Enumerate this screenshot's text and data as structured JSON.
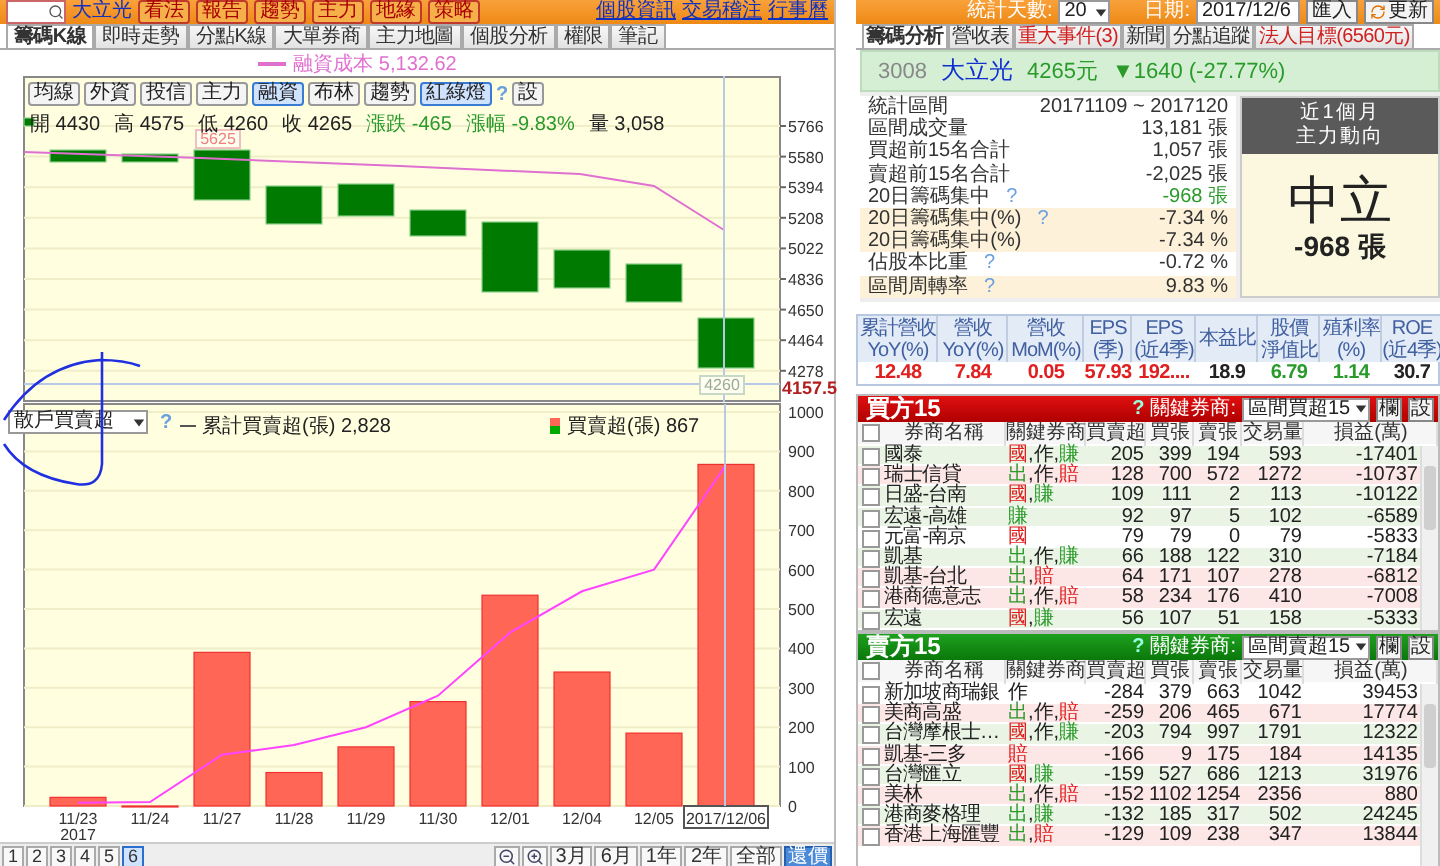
{
  "left_top_bar": {
    "stock_name": "大立光",
    "buttons": [
      "看法",
      "報告",
      "趨勢",
      "主力",
      "地緣",
      "策略"
    ],
    "links": [
      "個股資訊",
      "交易稽注",
      "行事曆"
    ]
  },
  "left_tabs": [
    {
      "label": "籌碼K線",
      "selected": true
    },
    {
      "label": "即時走勢",
      "selected": false
    },
    {
      "label": "分點K線",
      "selected": false
    },
    {
      "label": "大單券商",
      "selected": false
    },
    {
      "label": "主力地圖",
      "selected": false
    },
    {
      "label": "個股分析",
      "selected": false
    },
    {
      "label": "權限",
      "selected": false
    },
    {
      "label": "筆記",
      "selected": false
    }
  ],
  "cost_legend": "融資成本 5,132.62",
  "upper_chart": {
    "toolbar": [
      {
        "label": "均線",
        "selected": false
      },
      {
        "label": "外資",
        "selected": false
      },
      {
        "label": "投信",
        "selected": false
      },
      {
        "label": "主力",
        "selected": false
      },
      {
        "label": "融資",
        "selected": true
      },
      {
        "label": "布林",
        "selected": false
      },
      {
        "label": "趨勢",
        "selected": false
      },
      {
        "label": "紅綠燈",
        "selected": true
      }
    ],
    "help": "?",
    "settings": "設",
    "ohlc": [
      {
        "label": "開",
        "value": "4430",
        "color": "#222222"
      },
      {
        "label": "高",
        "value": "4575",
        "color": "#222222"
      },
      {
        "label": "低",
        "value": "4260",
        "color": "#222222"
      },
      {
        "label": "收",
        "value": "4265",
        "color": "#222222"
      },
      {
        "label": "漲跌",
        "value": "-465",
        "color": "#2a9a2a"
      },
      {
        "label": "漲幅",
        "value": "-9.83%",
        "color": "#2a9a2a"
      },
      {
        "label": "量",
        "value": "3,058",
        "color": "#222222"
      }
    ],
    "price_ticks": [
      "5766",
      "5580",
      "5394",
      "5208",
      "5022",
      "4836",
      "4650",
      "4464",
      "4278"
    ],
    "low_price": "4157.5",
    "high_tag": "5625",
    "low_tag": "4260"
  },
  "lower_chart": {
    "selector": "散戶買賣超",
    "help": "?",
    "legend_values": [
      "2,828",
      "867"
    ],
    "year_label": "2017",
    "chart_data": {
      "type": "bar",
      "categories": [
        "11/23",
        "11/24",
        "11/27",
        "11/28",
        "11/29",
        "11/30",
        "12/01",
        "12/04",
        "12/05",
        "2017/12/06"
      ],
      "series": [
        {
          "name": "累計買賣超(張)",
          "type": "line",
          "color": "#ff44ff",
          "values": [
            8,
            10,
            130,
            155,
            200,
            280,
            440,
            545,
            600,
            865
          ]
        },
        {
          "name": "買賣超(張)",
          "type": "bar",
          "color": "#ff6655",
          "values": [
            22,
            0,
            390,
            85,
            150,
            265,
            535,
            340,
            185,
            867
          ]
        }
      ],
      "grid": true,
      "ylim": [
        0,
        1000
      ],
      "yticks": [
        0,
        100,
        200,
        300,
        400,
        500,
        600,
        700,
        800,
        900,
        1000
      ]
    }
  },
  "bottom_bar": {
    "pages": [
      {
        "label": "1",
        "selected": false
      },
      {
        "label": "2",
        "selected": false
      },
      {
        "label": "3",
        "selected": false
      },
      {
        "label": "4",
        "selected": false
      },
      {
        "label": "5",
        "selected": false
      },
      {
        "label": "6",
        "selected": true
      }
    ],
    "ranges": [
      "3月",
      "6月",
      "1年",
      "2年",
      "全部"
    ],
    "restore": "還價"
  },
  "right_top_bar": {
    "days_label": "統計天數:",
    "days": "20",
    "date_label": "日期:",
    "date": "2017/12/6",
    "import": "匯入",
    "refresh": "更新"
  },
  "right_tabs": [
    {
      "label": "籌碼分析",
      "selected": true
    },
    {
      "label": "營收表",
      "selected": false
    },
    {
      "label": "重大事件(3)",
      "selected": false
    },
    {
      "label": "新聞",
      "selected": false
    },
    {
      "label": "分點追蹤",
      "selected": false
    },
    {
      "label": "法人目標(6560元)",
      "selected": false
    }
  ],
  "quote": {
    "code": "3008",
    "name": "大立光",
    "price": "4265元",
    "change": "▼1640 (-27.77%)"
  },
  "stats": [
    {
      "label": "統計區間",
      "value": "20171109 ~ 2017120",
      "highlighted": false,
      "color": "#333333"
    },
    {
      "label": "區間成交量",
      "value": "13,181 張",
      "highlighted": false,
      "color": "#333333"
    },
    {
      "label": "買超前15名合計",
      "value": "1,057 張",
      "highlighted": false,
      "color": "#333333"
    },
    {
      "label": "賣超前15名合計",
      "value": "-2,025 張",
      "highlighted": false,
      "color": "#333333"
    },
    {
      "label": "20日籌碼集中",
      "help": "?",
      "value": "-968 張",
      "highlighted": false,
      "color": "#2a9a2a"
    },
    {
      "label": "20日籌碼集中(%)",
      "help": "?",
      "value": "-7.34 %",
      "highlighted": true,
      "color": "#333333"
    },
    {
      "label": "20日籌碼集中(%)",
      "value": "-7.34 %",
      "highlighted": true,
      "color": "#333333"
    },
    {
      "label": "佔股本比重",
      "help": "?",
      "value": "-0.72 %",
      "highlighted": false,
      "color": "#333333"
    },
    {
      "label": "區間周轉率",
      "help": "?",
      "value": "9.83 %",
      "highlighted": true,
      "color": "#333333"
    }
  ],
  "trend": {
    "title": "近1個月",
    "subtitle": "主力動向",
    "verdict": "中立",
    "amount": "-968 張"
  },
  "metrics": [
    {
      "lines": [
        "累計營收",
        "YoY(%)"
      ],
      "value": "12.48",
      "color": "#e02020"
    },
    {
      "lines": [
        "營收",
        "YoY(%)"
      ],
      "value": "7.84",
      "color": "#e02020"
    },
    {
      "lines": [
        "營收",
        "MoM(%)"
      ],
      "value": "0.05",
      "color": "#e02020"
    },
    {
      "lines": [
        "EPS",
        "(季)"
      ],
      "value": "57.93",
      "color": "#e02020"
    },
    {
      "lines": [
        "EPS",
        "(近4季)"
      ],
      "value": "192....",
      "color": "#e02020"
    },
    {
      "lines": [
        "本益比"
      ],
      "value": "18.9",
      "color": "#222222"
    },
    {
      "lines": [
        "股價",
        "淨值比"
      ],
      "value": "6.79",
      "color": "#2a9a2a"
    },
    {
      "lines": [
        "殖利率",
        "(%)"
      ],
      "value": "1.14",
      "color": "#2a9a2a"
    },
    {
      "lines": [
        "ROE",
        "(近4季)"
      ],
      "value": "30.7",
      "color": "#222222"
    }
  ],
  "tables": [
    {
      "kind": "buy",
      "title": "買方15",
      "help": "?",
      "key_label": "關鍵券商:",
      "selector": "區間買超15",
      "buttons": [
        "欄",
        "設"
      ],
      "all_checked": false,
      "columns": [
        "券商名稱",
        "關鍵券商",
        "買賣超",
        "買張",
        "賣張",
        "交易量",
        "損益(萬)"
      ],
      "rows": [
        {
          "color": "#e9f4e4",
          "checked": false,
          "cells": [
            "國泰",
            {
              "tags": [
                {
                  "text": "國",
                  "color": "#e02020"
                },
                {
                  "text": ","
                },
                {
                  "text": "作",
                  "color": "#222222"
                },
                {
                  "text": ","
                },
                {
                  "text": "賺",
                  "color": "#2a9a2a"
                }
              ]
            },
            "205",
            "399",
            "194",
            "593",
            "-17401"
          ]
        },
        {
          "color": "#fde6e6",
          "checked": false,
          "cells": [
            "瑞士信貸",
            {
              "tags": [
                {
                  "text": "出",
                  "color": "#2a9a2a"
                },
                {
                  "text": ","
                },
                {
                  "text": "作",
                  "color": "#222222"
                },
                {
                  "text": ","
                },
                {
                  "text": "賠",
                  "color": "#e02020"
                }
              ]
            },
            "128",
            "700",
            "572",
            "1272",
            "-10737"
          ]
        },
        {
          "color": "#e9f4e4",
          "checked": false,
          "cells": [
            "日盛-台南",
            {
              "tags": [
                {
                  "text": "國",
                  "color": "#e02020"
                },
                {
                  "text": ","
                },
                {
                  "text": "賺",
                  "color": "#2a9a2a"
                }
              ]
            },
            "109",
            "111",
            "2",
            "113",
            "-10122"
          ]
        },
        {
          "color": "#e9f4e4",
          "checked": false,
          "cells": [
            "宏遠-高雄",
            {
              "tags": [
                {
                  "text": "賺",
                  "color": "#2a9a2a"
                }
              ]
            },
            "92",
            "97",
            "5",
            "102",
            "-6589"
          ]
        },
        {
          "color": "#ffffff",
          "checked": false,
          "cells": [
            "元富-南京",
            {
              "tags": [
                {
                  "text": "國",
                  "color": "#e02020"
                }
              ]
            },
            "79",
            "79",
            "0",
            "79",
            "-5833"
          ]
        },
        {
          "color": "#e9f4e4",
          "checked": false,
          "cells": [
            "凱基",
            {
              "tags": [
                {
                  "text": "出",
                  "color": "#2a9a2a"
                },
                {
                  "text": ","
                },
                {
                  "text": "作",
                  "color": "#222222"
                },
                {
                  "text": ","
                },
                {
                  "text": "賺",
                  "color": "#2a9a2a"
                }
              ]
            },
            "66",
            "188",
            "122",
            "310",
            "-7184"
          ]
        },
        {
          "color": "#fde6e6",
          "checked": false,
          "cells": [
            "凱基-台北",
            {
              "tags": [
                {
                  "text": "出",
                  "color": "#2a9a2a"
                },
                {
                  "text": ","
                },
                {
                  "text": "賠",
                  "color": "#e02020"
                }
              ]
            },
            "64",
            "171",
            "107",
            "278",
            "-6812"
          ]
        },
        {
          "color": "#fde6e6",
          "checked": false,
          "cells": [
            "港商德意志",
            {
              "tags": [
                {
                  "text": "出",
                  "color": "#2a9a2a"
                },
                {
                  "text": ","
                },
                {
                  "text": "作",
                  "color": "#222222"
                },
                {
                  "text": ","
                },
                {
                  "text": "賠",
                  "color": "#e02020"
                }
              ]
            },
            "58",
            "234",
            "176",
            "410",
            "-7008"
          ]
        },
        {
          "color": "#e9f4e4",
          "checked": false,
          "cells": [
            "宏遠",
            {
              "tags": [
                {
                  "text": "國",
                  "color": "#e02020"
                },
                {
                  "text": ","
                },
                {
                  "text": "賺",
                  "color": "#2a9a2a"
                }
              ]
            },
            "56",
            "107",
            "51",
            "158",
            "-5333"
          ]
        }
      ]
    },
    {
      "kind": "sell",
      "title": "賣方15",
      "help": "?",
      "key_label": "關鍵券商:",
      "selector": "區間賣超15",
      "buttons": [
        "欄",
        "設"
      ],
      "all_checked": false,
      "columns": [
        "券商名稱",
        "關鍵券商",
        "買賣超",
        "買張",
        "賣張",
        "交易量",
        "損益(萬)"
      ],
      "rows": [
        {
          "color": "#ffffff",
          "checked": false,
          "cells": [
            "新加坡商瑞銀",
            {
              "tags": [
                {
                  "text": "作",
                  "color": "#222222"
                }
              ]
            },
            "-284",
            "379",
            "663",
            "1042",
            "39453"
          ]
        },
        {
          "color": "#fde6e6",
          "checked": false,
          "cells": [
            "美商高盛",
            {
              "tags": [
                {
                  "text": "出",
                  "color": "#2a9a2a"
                },
                {
                  "text": ","
                },
                {
                  "text": "作",
                  "color": "#222222"
                },
                {
                  "text": ","
                },
                {
                  "text": "賠",
                  "color": "#e02020"
                }
              ]
            },
            "-259",
            "206",
            "465",
            "671",
            "17774"
          ]
        },
        {
          "color": "#e9f4e4",
          "checked": false,
          "cells": [
            "台灣摩根士…",
            {
              "tags": [
                {
                  "text": "國",
                  "color": "#e02020"
                },
                {
                  "text": ","
                },
                {
                  "text": "作",
                  "color": "#222222"
                },
                {
                  "text": ","
                },
                {
                  "text": "賺",
                  "color": "#2a9a2a"
                }
              ]
            },
            "-203",
            "794",
            "997",
            "1791",
            "12322"
          ]
        },
        {
          "color": "#fde6e6",
          "checked": false,
          "cells": [
            "凱基-三多",
            {
              "tags": [
                {
                  "text": "賠",
                  "color": "#e02020"
                }
              ]
            },
            "-166",
            "9",
            "175",
            "184",
            "14135"
          ]
        },
        {
          "color": "#e9f4e4",
          "checked": false,
          "cells": [
            "台灣匯立",
            {
              "tags": [
                {
                  "text": "國",
                  "color": "#e02020"
                },
                {
                  "text": ","
                },
                {
                  "text": "賺",
                  "color": "#2a9a2a"
                }
              ]
            },
            "-159",
            "527",
            "686",
            "1213",
            "31976"
          ]
        },
        {
          "color": "#fde6e6",
          "checked": false,
          "cells": [
            "美林",
            {
              "tags": [
                {
                  "text": "出",
                  "color": "#2a9a2a"
                },
                {
                  "text": ","
                },
                {
                  "text": "作",
                  "color": "#222222"
                },
                {
                  "text": ","
                },
                {
                  "text": "賠",
                  "color": "#e02020"
                }
              ]
            },
            "-152",
            "1102",
            "1254",
            "2356",
            "880"
          ]
        },
        {
          "color": "#e9f4e4",
          "checked": false,
          "cells": [
            "港商麥格理",
            {
              "tags": [
                {
                  "text": "出",
                  "color": "#2a9a2a"
                },
                {
                  "text": ","
                },
                {
                  "text": "賺",
                  "color": "#2a9a2a"
                }
              ]
            },
            "-132",
            "185",
            "317",
            "502",
            "24245"
          ]
        },
        {
          "color": "#fde6e6",
          "checked": false,
          "cells": [
            "香港上海匯豐",
            {
              "tags": [
                {
                  "text": "出",
                  "color": "#2a9a2a"
                },
                {
                  "text": ","
                },
                {
                  "text": "賠",
                  "color": "#e02020"
                }
              ]
            },
            "-129",
            "109",
            "238",
            "347",
            "13844"
          ]
        }
      ]
    }
  ]
}
